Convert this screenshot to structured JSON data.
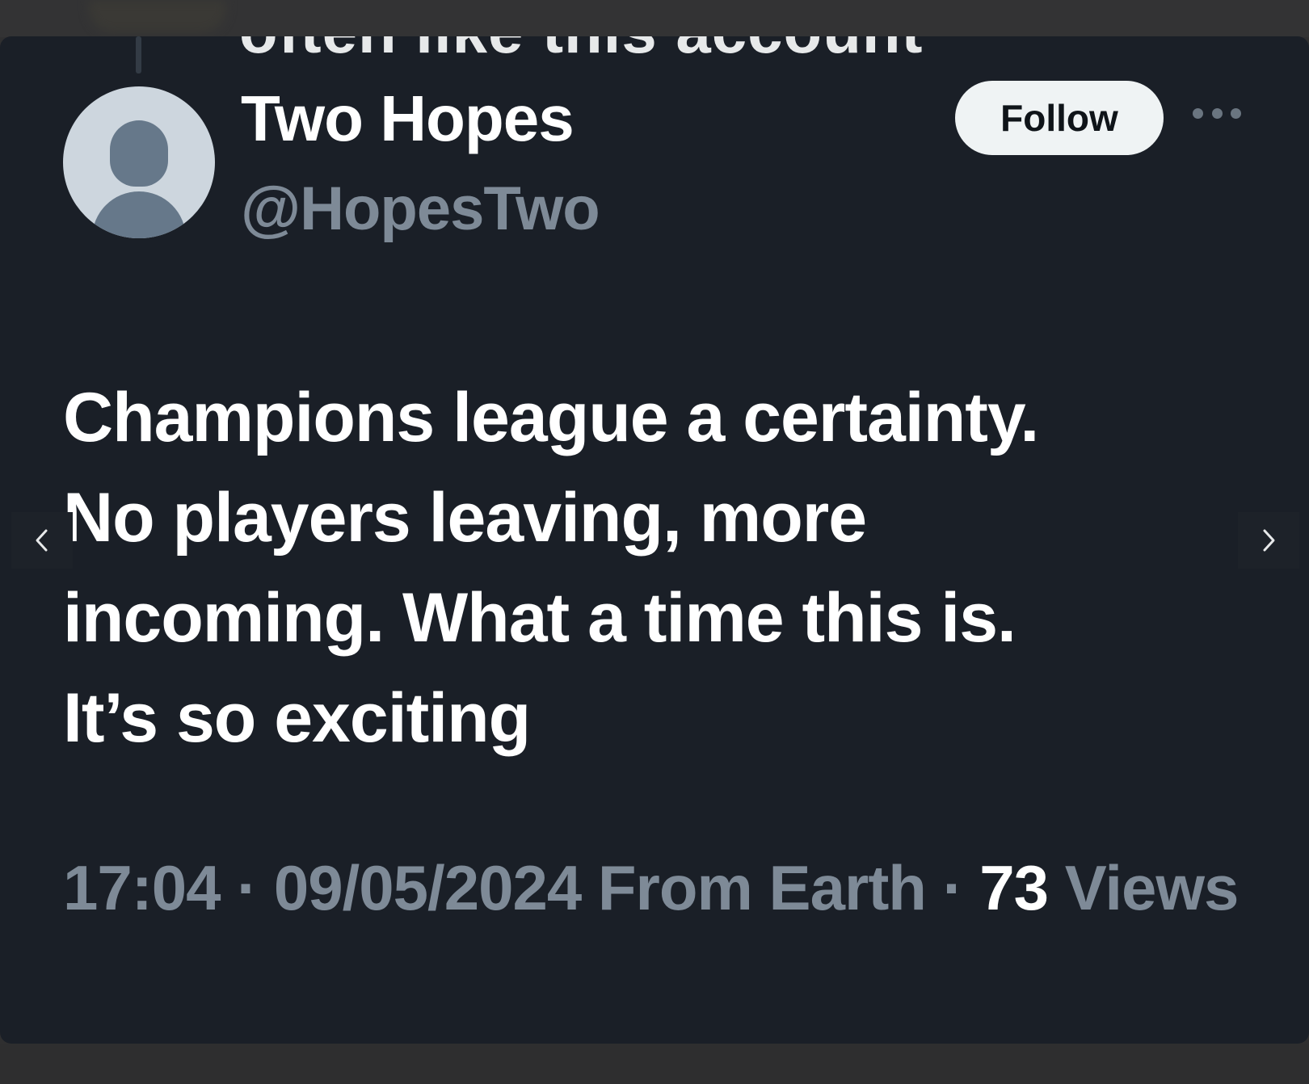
{
  "clipped_header_text": "often like this account",
  "author": {
    "display_name": "Two Hopes",
    "handle": "@HopesTwo",
    "avatar_icon": "default-avatar-icon"
  },
  "actions": {
    "follow_label": "Follow",
    "more_icon": "more-horizontal-icon"
  },
  "tweet": {
    "text": "Champions league a certainty.\nNo players leaving,  more\nincoming. What a time this is.\nIt’s so exciting"
  },
  "meta": {
    "time": "17:04",
    "date": "09/05/2024",
    "location": "From Earth",
    "separator": "·",
    "views_count": "73",
    "views_label": "Views"
  },
  "navigation": {
    "prev_icon": "chevron-left-icon",
    "next_icon": "chevron-right-icon"
  },
  "colors": {
    "card_background": "#1a1f27",
    "primary_text": "#ffffff",
    "secondary_text": "#7e8a97",
    "follow_button_bg": "#eff3f4"
  }
}
